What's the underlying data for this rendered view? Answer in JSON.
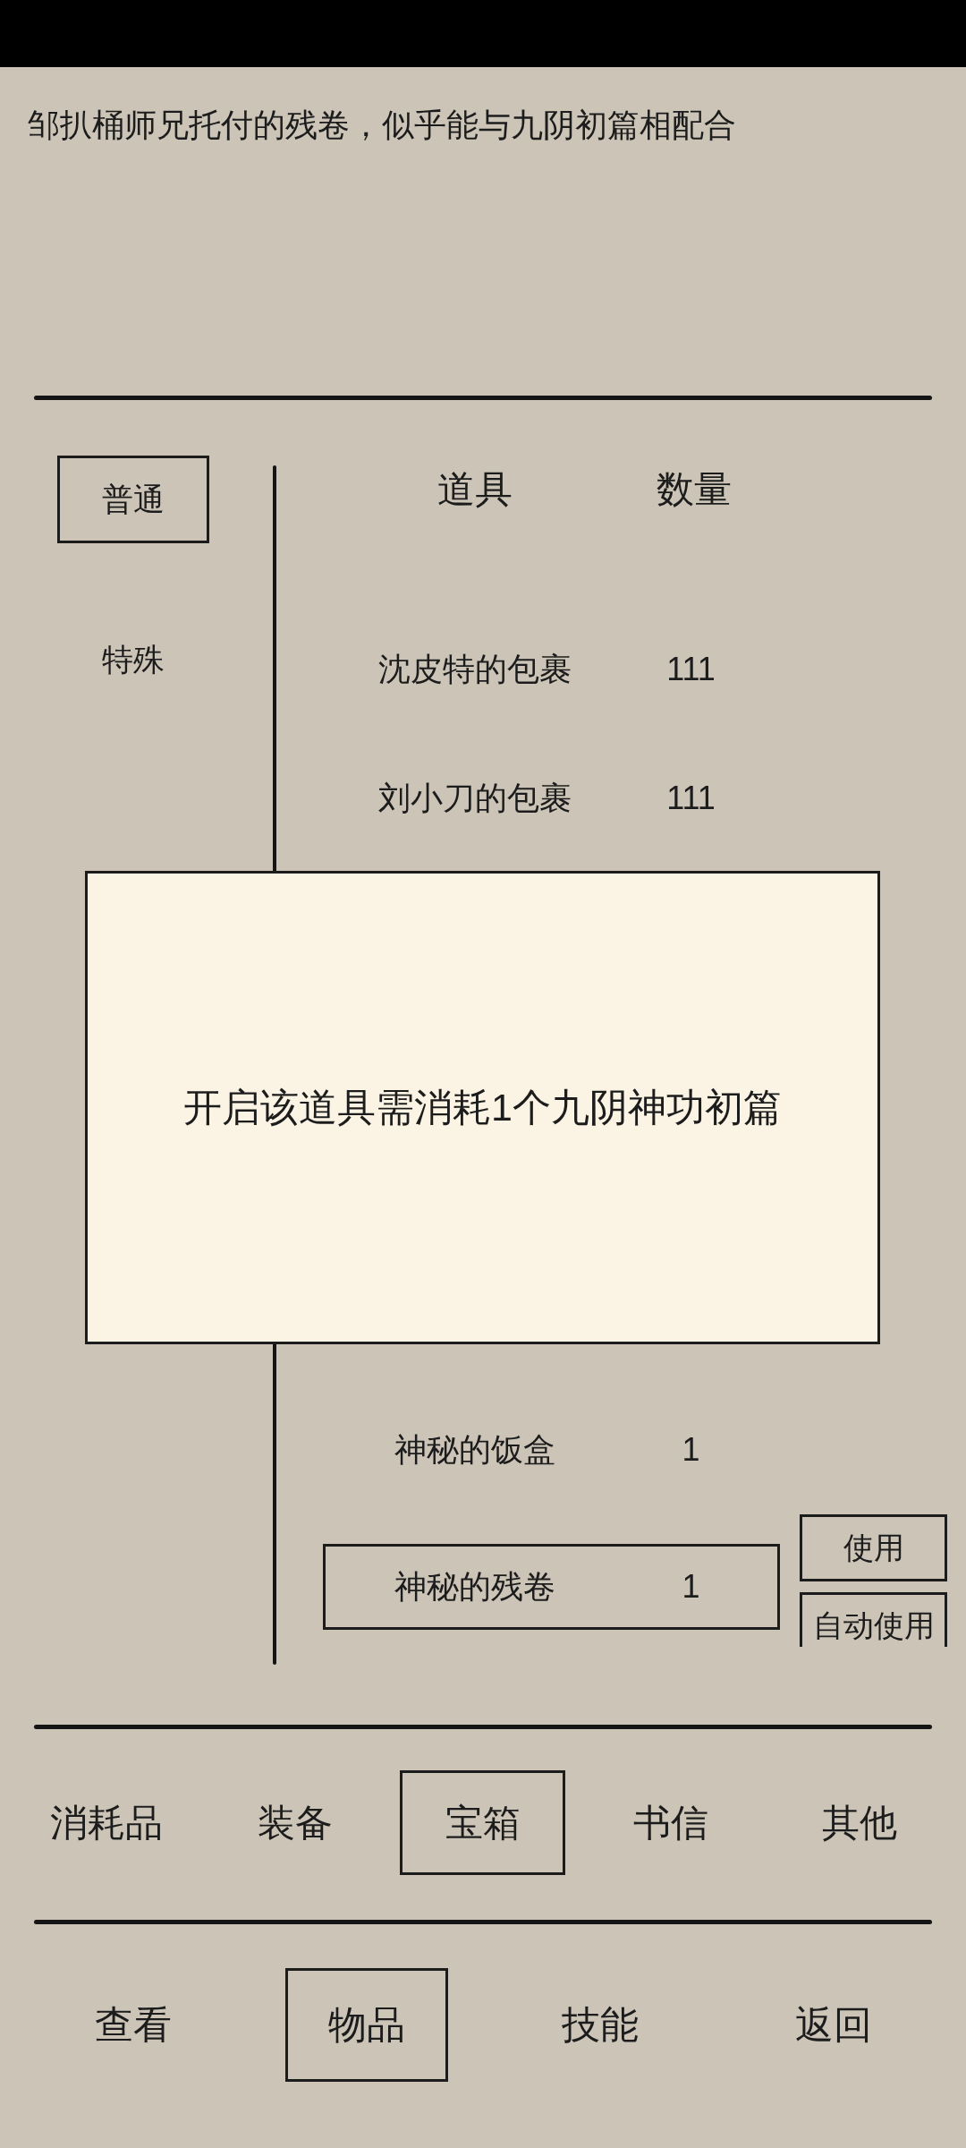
{
  "description": "邹扒桶师兄托付的残卷，似乎能与九阴初篇相配合",
  "side_tabs": [
    {
      "label": "普通",
      "selected": true
    },
    {
      "label": "特殊",
      "selected": false
    }
  ],
  "item_list": {
    "columns": [
      "道具",
      "数量"
    ],
    "rows_above_popup": [
      {
        "name": "沈皮特的包裹",
        "count": "111",
        "selected": false
      },
      {
        "name": "刘小刀的包裹",
        "count": "111",
        "selected": false
      }
    ],
    "rows_below_popup": [
      {
        "name": "神秘的饭盒",
        "count": "1",
        "selected": false
      },
      {
        "name": "神秘的残卷",
        "count": "1",
        "selected": true
      }
    ],
    "actions": [
      "使用",
      "自动使用"
    ]
  },
  "popup": {
    "message": "开启该道具需消耗1个九阴神功初篇"
  },
  "category_tabs": [
    {
      "label": "消耗品",
      "selected": false
    },
    {
      "label": "装备",
      "selected": false
    },
    {
      "label": "宝箱",
      "selected": true
    },
    {
      "label": "书信",
      "selected": false
    },
    {
      "label": "其他",
      "selected": false
    }
  ],
  "nav_tabs": [
    {
      "label": "查看",
      "selected": false
    },
    {
      "label": "物品",
      "selected": true
    },
    {
      "label": "技能",
      "selected": false
    },
    {
      "label": "返回",
      "selected": false
    }
  ]
}
